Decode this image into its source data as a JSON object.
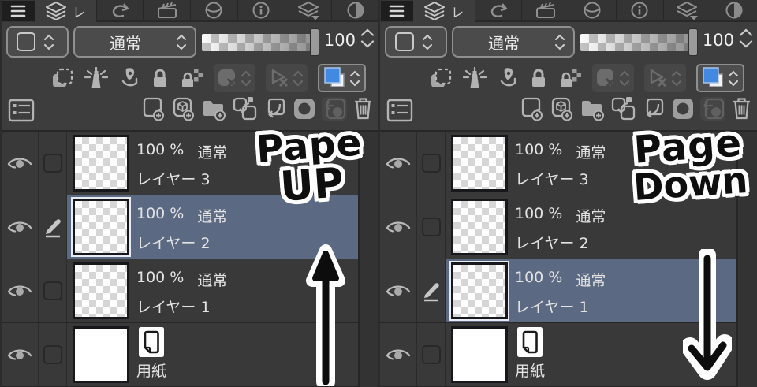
{
  "shared": {
    "tabs": {
      "active_label": "レ",
      "icons": [
        "menu-icon",
        "layers-stack-icon",
        "undo-arrow-icon",
        "clapperboard-icon",
        "sphere-icon",
        "info-icon",
        "layer-property-icon",
        "tone-circle-icon"
      ]
    },
    "toolbar_icons": {
      "toggles": [
        "clip-to-layer-below-icon",
        "reference-layer-icon",
        "draft-layer-icon",
        "lock-layer-icon",
        "lock-transparent-pixels-icon",
        "enable-mask-icon",
        "ruler-range-icon",
        "layer-color-icon"
      ],
      "commands": [
        "palette-options-icon",
        "new-raster-layer-icon",
        "new-vector-layer-icon",
        "new-folder-icon",
        "transfer-down-icon",
        "merge-down-icon",
        "create-mask-icon",
        "apply-mask-icon",
        "delete-layer-icon"
      ],
      "row_icons": [
        "eye-icon",
        "checkbox",
        "pencil-icon",
        "paper-icon"
      ]
    },
    "colors": {
      "selection": "#5c6983",
      "layer_color_blue": "#4289e2",
      "panel_bg": "#3d3d3d"
    }
  },
  "panels": [
    {
      "side": "left",
      "blend": {
        "mode": "通常",
        "opacity": "100"
      },
      "layers": [
        {
          "opacity": "100 %",
          "blend": "通常",
          "name": "レイヤー 3",
          "type": "normal",
          "selected": false
        },
        {
          "opacity": "100 %",
          "blend": "通常",
          "name": "レイヤー 2",
          "type": "normal",
          "selected": true
        },
        {
          "opacity": "100 %",
          "blend": "通常",
          "name": "レイヤー 1",
          "type": "normal",
          "selected": false
        },
        {
          "name": "用紙",
          "type": "paper",
          "selected": false
        }
      ],
      "annotation": {
        "line1": "Pape",
        "line2": "UP",
        "arrow": "up"
      }
    },
    {
      "side": "right",
      "blend": {
        "mode": "通常",
        "opacity": "100"
      },
      "layers": [
        {
          "opacity": "100 %",
          "blend": "通常",
          "name": "レイヤー 3",
          "type": "normal",
          "selected": false
        },
        {
          "opacity": "100 %",
          "blend": "通常",
          "name": "レイヤー 2",
          "type": "normal",
          "selected": false
        },
        {
          "opacity": "100 %",
          "blend": "通常",
          "name": "レイヤー 1",
          "type": "normal",
          "selected": true
        },
        {
          "name": "用紙",
          "type": "paper",
          "selected": false
        }
      ],
      "annotation": {
        "line1": "Page",
        "line2": "Down",
        "arrow": "down"
      }
    }
  ]
}
